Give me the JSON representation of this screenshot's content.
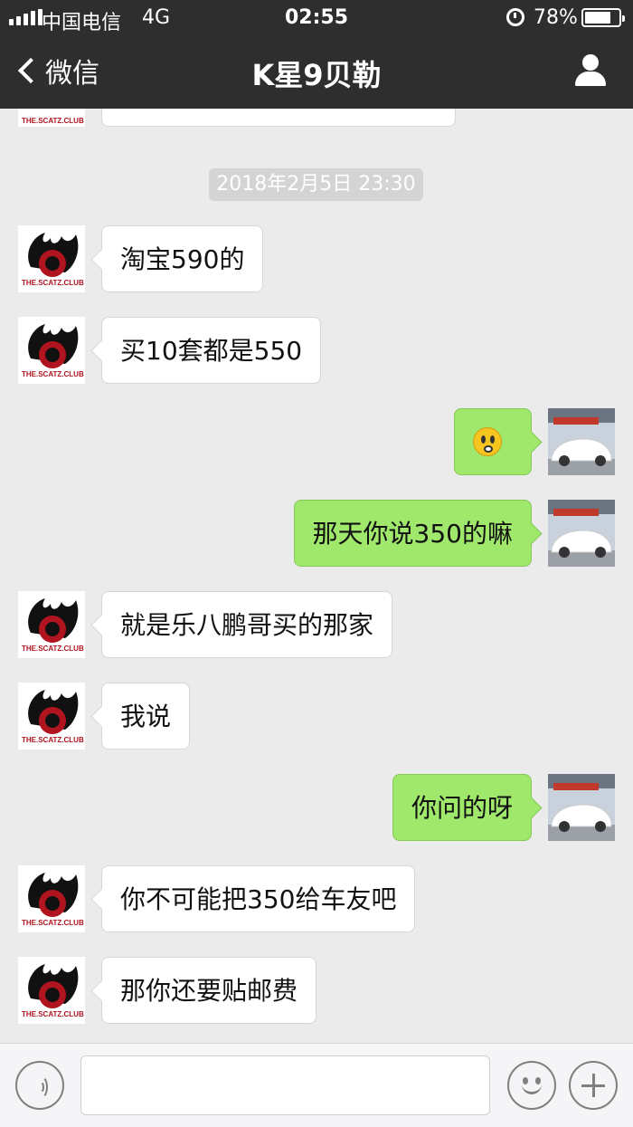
{
  "status_bar": {
    "carrier": "中国电信",
    "network": "4G",
    "time": "02:55",
    "battery_percent": "78%",
    "battery_level": 0.78,
    "icons": [
      "signal-icon",
      "alarm-icon",
      "battery-icon"
    ]
  },
  "nav": {
    "back_label": "微信",
    "title": "K星9贝勒",
    "icons": [
      "chevron-left-icon",
      "profile-icon"
    ]
  },
  "chat": {
    "timestamp": "2018年2月5日 23:30",
    "messages": [
      {
        "from": "other",
        "text": ""
      },
      {
        "from": "other",
        "text": "淘宝590的"
      },
      {
        "from": "other",
        "text": "买10套都是550"
      },
      {
        "from": "me",
        "text": "",
        "emoji": "flushed-face-icon"
      },
      {
        "from": "me",
        "text": "那天你说350的嘛"
      },
      {
        "from": "other",
        "text": "就是乐八鹏哥买的那家"
      },
      {
        "from": "other",
        "text": "我说"
      },
      {
        "from": "me",
        "text": "你问的呀"
      },
      {
        "from": "other",
        "text": "你不可能把350给车友吧"
      },
      {
        "from": "other",
        "text": "那你还要贴邮费"
      }
    ],
    "other_avatar": {
      "logo_text": "THE.SCATZ.CLUB",
      "colors": {
        "flame": "#111111",
        "ring": "#b0141e"
      }
    },
    "my_avatar": {
      "colors": {
        "car": "#ffffff",
        "sky": "#c9d2dc",
        "awning": "#c0392b"
      }
    }
  },
  "input_bar": {
    "icons": [
      "voice-icon",
      "emoji-icon",
      "plus-icon"
    ]
  },
  "colors": {
    "header_bg": "#2e2e2e",
    "chat_bg": "#ebebeb",
    "outgoing_bubble": "#9fe86b",
    "incoming_bubble": "#ffffff"
  }
}
